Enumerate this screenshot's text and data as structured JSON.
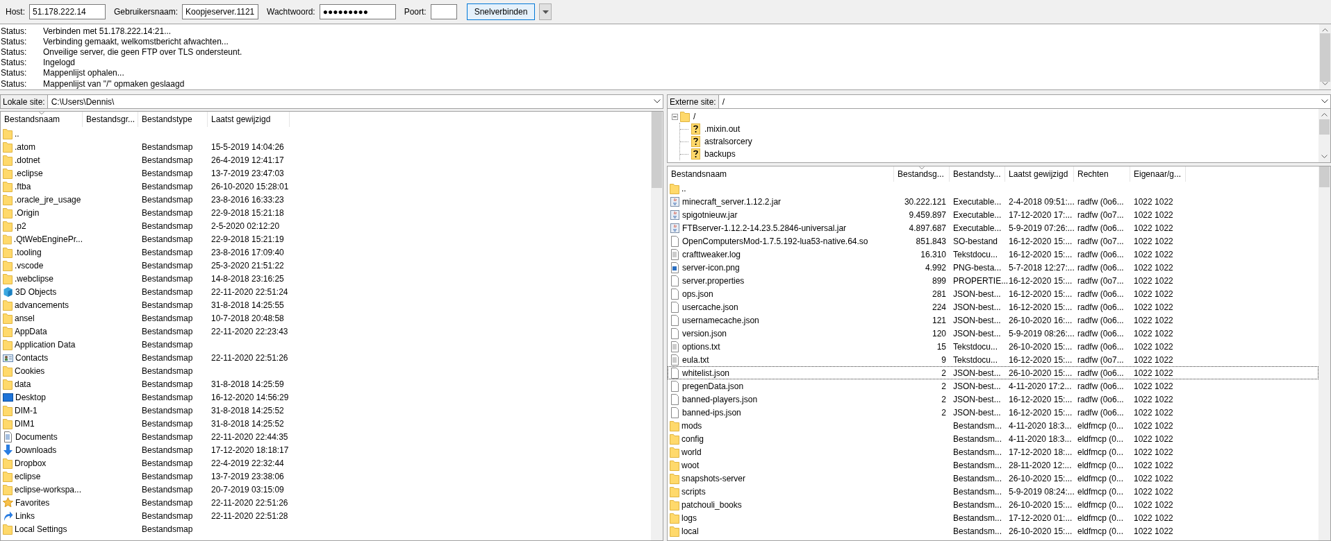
{
  "quickconnect": {
    "fields": [
      {
        "label": "Host:",
        "value": "51.178.222.14",
        "kind": "text"
      },
      {
        "label": "Gebruikersnaam:",
        "value": "Koopjeserver.1121",
        "kind": "text"
      },
      {
        "label": "Wachtwoord:",
        "value": "●●●●●●●●●",
        "kind": "password"
      },
      {
        "label": "Poort:",
        "kind": "short"
      }
    ],
    "button": "Snelverbinden"
  },
  "log": [
    {
      "type": "Status:",
      "message": "Verbinden met 51.178.222.14:21..."
    },
    {
      "type": "Status:",
      "message": "Verbinding gemaakt, welkomstbericht afwachten..."
    },
    {
      "type": "Status:",
      "message": "Onveilige server, die geen FTP over TLS ondersteunt."
    },
    {
      "type": "Status:",
      "message": "Ingelogd"
    },
    {
      "type": "Status:",
      "message": "Mappenlijst ophalen..."
    },
    {
      "type": "Status:",
      "message": "Mappenlijst van \"/\" opmaken geslaagd"
    }
  ],
  "local": {
    "label": "Lokale site:",
    "path": "C:\\Users\\Dennis\\",
    "columns": [
      {
        "label": "Bestandsnaam",
        "sorted": true
      },
      {
        "label": "Bestandsgr...",
        "sorted": false
      },
      {
        "label": "Bestandstype",
        "sorted": false
      },
      {
        "label": "Laatst gewijzigd",
        "sorted": false
      }
    ],
    "rows": [
      {
        "kind": "folder",
        "name": ".."
      },
      {
        "kind": "folder",
        "name": ".atom",
        "type": "Bestandsmap",
        "modified": "15-5-2019 14:04:26"
      },
      {
        "kind": "folder",
        "name": ".dotnet",
        "type": "Bestandsmap",
        "modified": "26-4-2019 12:41:17"
      },
      {
        "kind": "folder",
        "name": ".eclipse",
        "type": "Bestandsmap",
        "modified": "13-7-2019 23:47:03"
      },
      {
        "kind": "folder",
        "name": ".ftba",
        "type": "Bestandsmap",
        "modified": "26-10-2020 15:28:01"
      },
      {
        "kind": "folder",
        "name": ".oracle_jre_usage",
        "type": "Bestandsmap",
        "modified": "23-8-2016 16:33:23"
      },
      {
        "kind": "folder",
        "name": ".Origin",
        "type": "Bestandsmap",
        "modified": "22-9-2018 15:21:18"
      },
      {
        "kind": "folder",
        "name": ".p2",
        "type": "Bestandsmap",
        "modified": "2-5-2020 02:12:20"
      },
      {
        "kind": "folder",
        "name": ".QtWebEnginePr...",
        "type": "Bestandsmap",
        "modified": "22-9-2018 15:21:19"
      },
      {
        "kind": "folder",
        "name": ".tooling",
        "type": "Bestandsmap",
        "modified": "23-8-2016 17:09:40"
      },
      {
        "kind": "folder",
        "name": ".vscode",
        "type": "Bestandsmap",
        "modified": "25-3-2020 21:51:22"
      },
      {
        "kind": "folder",
        "name": ".webclipse",
        "type": "Bestandsmap",
        "modified": "14-8-2018 23:16:25"
      },
      {
        "kind": "cube",
        "name": "3D Objects",
        "type": "Bestandsmap",
        "modified": "22-11-2020 22:51:24"
      },
      {
        "kind": "folder",
        "name": "advancements",
        "type": "Bestandsmap",
        "modified": "31-8-2018 14:25:55"
      },
      {
        "kind": "folder",
        "name": "ansel",
        "type": "Bestandsmap",
        "modified": "10-7-2018 20:48:58"
      },
      {
        "kind": "folder",
        "name": "AppData",
        "type": "Bestandsmap",
        "modified": "22-11-2020 22:23:43"
      },
      {
        "kind": "folder",
        "name": "Application Data",
        "type": "Bestandsmap"
      },
      {
        "kind": "contacts",
        "name": "Contacts",
        "type": "Bestandsmap",
        "modified": "22-11-2020 22:51:26"
      },
      {
        "kind": "folder",
        "name": "Cookies",
        "type": "Bestandsmap"
      },
      {
        "kind": "folder",
        "name": "data",
        "type": "Bestandsmap",
        "modified": "31-8-2018 14:25:59"
      },
      {
        "kind": "desktop",
        "name": "Desktop",
        "type": "Bestandsmap",
        "modified": "16-12-2020 14:56:29"
      },
      {
        "kind": "folder",
        "name": "DIM-1",
        "type": "Bestandsmap",
        "modified": "31-8-2018 14:25:52"
      },
      {
        "kind": "folder",
        "name": "DIM1",
        "type": "Bestandsmap",
        "modified": "31-8-2018 14:25:52"
      },
      {
        "kind": "documents",
        "name": "Documents",
        "type": "Bestandsmap",
        "modified": "22-11-2020 22:44:35"
      },
      {
        "kind": "downloads",
        "name": "Downloads",
        "type": "Bestandsmap",
        "modified": "17-12-2020 18:18:17"
      },
      {
        "kind": "folder",
        "name": "Dropbox",
        "type": "Bestandsmap",
        "modified": "22-4-2019 22:32:44"
      },
      {
        "kind": "folder",
        "name": "eclipse",
        "type": "Bestandsmap",
        "modified": "13-7-2019 23:38:06"
      },
      {
        "kind": "folder",
        "name": "eclipse-workspa...",
        "type": "Bestandsmap",
        "modified": "20-7-2019 03:15:09"
      },
      {
        "kind": "favorites",
        "name": "Favorites",
        "type": "Bestandsmap",
        "modified": "22-11-2020 22:51:26"
      },
      {
        "kind": "links",
        "name": "Links",
        "type": "Bestandsmap",
        "modified": "22-11-2020 22:51:28"
      },
      {
        "kind": "folder",
        "name": "Local Settings",
        "type": "Bestandsmap"
      }
    ]
  },
  "remote": {
    "label": "Externe site:",
    "path": "/",
    "tree": [
      {
        "kind": "folder",
        "name": "/",
        "expanded": true,
        "children": [
          {
            "kind": "unknown",
            "name": ".mixin.out"
          },
          {
            "kind": "unknown",
            "name": "astralsorcery"
          },
          {
            "kind": "unknown",
            "name": "backups"
          }
        ]
      }
    ],
    "columns": [
      {
        "label": "Bestandsnaam",
        "sorted": false
      },
      {
        "label": "Bestandsg...",
        "sorted": true
      },
      {
        "label": "Bestandsty...",
        "sorted": false
      },
      {
        "label": "Laatst gewijzigd",
        "sorted": false
      },
      {
        "label": "Rechten",
        "sorted": false
      },
      {
        "label": "Eigenaar/g...",
        "sorted": false
      }
    ],
    "rows": [
      {
        "kind": "folder",
        "name": "..",
        "focused": false
      },
      {
        "kind": "jar",
        "name": "minecraft_server.1.12.2.jar",
        "size": "30.222.121",
        "type": "Executable...",
        "modified": "2-4-2018 09:51:...",
        "permissions": "radfw (0o6...",
        "owner": "1022 1022",
        "focused": false
      },
      {
        "kind": "jar",
        "name": "spigotnieuw.jar",
        "size": "9.459.897",
        "type": "Executable...",
        "modified": "17-12-2020 17:...",
        "permissions": "radfw (0o7...",
        "owner": "1022 1022",
        "focused": false
      },
      {
        "kind": "jar",
        "name": "FTBserver-1.12.2-14.23.5.2846-universal.jar",
        "size": "4.897.687",
        "type": "Executable...",
        "modified": "5-9-2019 07:26:...",
        "permissions": "radfw (0o6...",
        "owner": "1022 1022",
        "focused": false
      },
      {
        "kind": "file",
        "name": "OpenComputersMod-1.7.5.192-lua53-native.64.so",
        "size": "851.843",
        "type": "SO-bestand",
        "modified": "16-12-2020 15:...",
        "permissions": "radfw (0o7...",
        "owner": "1022 1022",
        "focused": false
      },
      {
        "kind": "text",
        "name": "crafttweaker.log",
        "size": "16.310",
        "type": "Tekstdocu...",
        "modified": "16-12-2020 15:...",
        "permissions": "radfw (0o6...",
        "owner": "1022 1022",
        "focused": false
      },
      {
        "kind": "image",
        "name": "server-icon.png",
        "size": "4.992",
        "type": "PNG-besta...",
        "modified": "5-7-2018 12:27:...",
        "permissions": "radfw (0o6...",
        "owner": "1022 1022",
        "focused": false
      },
      {
        "kind": "file",
        "name": "server.properties",
        "size": "899",
        "type": "PROPERTIE...",
        "modified": "16-12-2020 15:...",
        "permissions": "radfw (0o7...",
        "owner": "1022 1022",
        "focused": false
      },
      {
        "kind": "file",
        "name": "ops.json",
        "size": "281",
        "type": "JSON-best...",
        "modified": "16-12-2020 15:...",
        "permissions": "radfw (0o6...",
        "owner": "1022 1022",
        "focused": false
      },
      {
        "kind": "file",
        "name": "usercache.json",
        "size": "224",
        "type": "JSON-best...",
        "modified": "16-12-2020 15:...",
        "permissions": "radfw (0o6...",
        "owner": "1022 1022",
        "focused": false
      },
      {
        "kind": "file",
        "name": "usernamecache.json",
        "size": "121",
        "type": "JSON-best...",
        "modified": "26-10-2020 16:...",
        "permissions": "radfw (0o6...",
        "owner": "1022 1022",
        "focused": false
      },
      {
        "kind": "file",
        "name": "version.json",
        "size": "120",
        "type": "JSON-best...",
        "modified": "5-9-2019 08:26:...",
        "permissions": "radfw (0o6...",
        "owner": "1022 1022",
        "focused": false
      },
      {
        "kind": "text",
        "name": "options.txt",
        "size": "15",
        "type": "Tekstdocu...",
        "modified": "26-10-2020 15:...",
        "permissions": "radfw (0o6...",
        "owner": "1022 1022",
        "focused": false
      },
      {
        "kind": "text",
        "name": "eula.txt",
        "size": "9",
        "type": "Tekstdocu...",
        "modified": "16-12-2020 15:...",
        "permissions": "radfw (0o7...",
        "owner": "1022 1022",
        "focused": false
      },
      {
        "kind": "file",
        "name": "whitelist.json",
        "size": "2",
        "type": "JSON-best...",
        "modified": "26-10-2020 15:...",
        "permissions": "radfw (0o6...",
        "owner": "1022 1022",
        "focused": true
      },
      {
        "kind": "file",
        "name": "pregenData.json",
        "size": "2",
        "type": "JSON-best...",
        "modified": "4-11-2020 17:2...",
        "permissions": "radfw (0o6...",
        "owner": "1022 1022",
        "focused": false
      },
      {
        "kind": "file",
        "name": "banned-players.json",
        "size": "2",
        "type": "JSON-best...",
        "modified": "16-12-2020 15:...",
        "permissions": "radfw (0o6...",
        "owner": "1022 1022",
        "focused": false
      },
      {
        "kind": "file",
        "name": "banned-ips.json",
        "size": "2",
        "type": "JSON-best...",
        "modified": "16-12-2020 15:...",
        "permissions": "radfw (0o6...",
        "owner": "1022 1022",
        "focused": false
      },
      {
        "kind": "folder",
        "name": "mods",
        "type": "Bestandsm...",
        "modified": "4-11-2020 18:3...",
        "permissions": "eldfmcp (0...",
        "owner": "1022 1022",
        "focused": false
      },
      {
        "kind": "folder",
        "name": "config",
        "type": "Bestandsm...",
        "modified": "4-11-2020 18:3...",
        "permissions": "eldfmcp (0...",
        "owner": "1022 1022",
        "focused": false
      },
      {
        "kind": "folder",
        "name": "world",
        "type": "Bestandsm...",
        "modified": "17-12-2020 18:...",
        "permissions": "eldfmcp (0...",
        "owner": "1022 1022",
        "focused": false
      },
      {
        "kind": "folder",
        "name": "woot",
        "type": "Bestandsm...",
        "modified": "28-11-2020 12:...",
        "permissions": "eldfmcp (0...",
        "owner": "1022 1022",
        "focused": false
      },
      {
        "kind": "folder",
        "name": "snapshots-server",
        "type": "Bestandsm...",
        "modified": "26-10-2020 15:...",
        "permissions": "eldfmcp (0...",
        "owner": "1022 1022",
        "focused": false
      },
      {
        "kind": "folder",
        "name": "scripts",
        "type": "Bestandsm...",
        "modified": "5-9-2019 08:24:...",
        "permissions": "eldfmcp (0...",
        "owner": "1022 1022",
        "focused": false
      },
      {
        "kind": "folder",
        "name": "patchouli_books",
        "type": "Bestandsm...",
        "modified": "26-10-2020 15:...",
        "permissions": "eldfmcp (0...",
        "owner": "1022 1022",
        "focused": false
      },
      {
        "kind": "folder",
        "name": "logs",
        "type": "Bestandsm...",
        "modified": "17-12-2020 01:...",
        "permissions": "eldfmcp (0...",
        "owner": "1022 1022",
        "focused": false
      },
      {
        "kind": "folder",
        "name": "local",
        "type": "Bestandsm...",
        "modified": "26-10-2020 15:...",
        "permissions": "eldfmcp (0...",
        "owner": "1022 1022",
        "focused": false
      }
    ]
  }
}
